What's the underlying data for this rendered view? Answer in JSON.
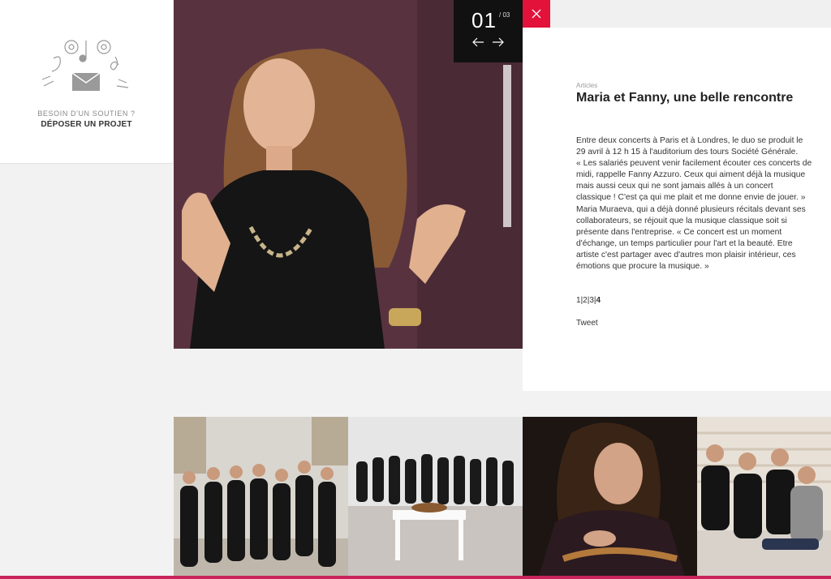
{
  "sidebar": {
    "cta_line1": "BESOIN D'UN SOUTIEN ?",
    "cta_line2": "DÉPOSER UN PROJET",
    "icon": "music-notes-envelope-icon"
  },
  "slider": {
    "current": "01",
    "total": "/ 03",
    "prev_icon": "arrow-left-icon",
    "next_icon": "arrow-right-icon",
    "close_icon": "close-icon"
  },
  "article": {
    "category": "Articles",
    "title": "Maria et Fanny, une belle rencontre",
    "lines": [
      " Entre deux concerts à Paris et à Londres, le duo se produit le",
      "29 avril à 12 h 15 à l'auditorium des tours Société Générale.",
      "« Les salariés peuvent venir facilement écouter ces concerts de",
      "midi, rappelle Fanny Azzuro. Ceux qui aiment déjà la musique",
      "mais aussi ceux qui ne sont jamais allés à un concert",
      "classique ! C'est ça qui me plait et me donne envie de jouer. »",
      "Maria Muraeva, qui a déjà donné plusieurs récitals devant ses",
      "collaborateurs, se réjouit que la musique classique soit si",
      "présente dans l'entreprise. « Ce concert est un moment",
      "d'échange, un temps particulier pour l'art et la beauté. Etre",
      "artiste c'est partager avec d'autres mon plaisir intérieur, ces",
      "émotions que procure la musique. »"
    ],
    "pages": [
      "1",
      "2",
      "3",
      "4"
    ],
    "separator": "|",
    "tweet": "Tweet"
  },
  "colors": {
    "accent": "#e2123a",
    "counter_bg": "#111111",
    "hero_bg": "#58333f",
    "bottom_bar": "#c8235a"
  }
}
